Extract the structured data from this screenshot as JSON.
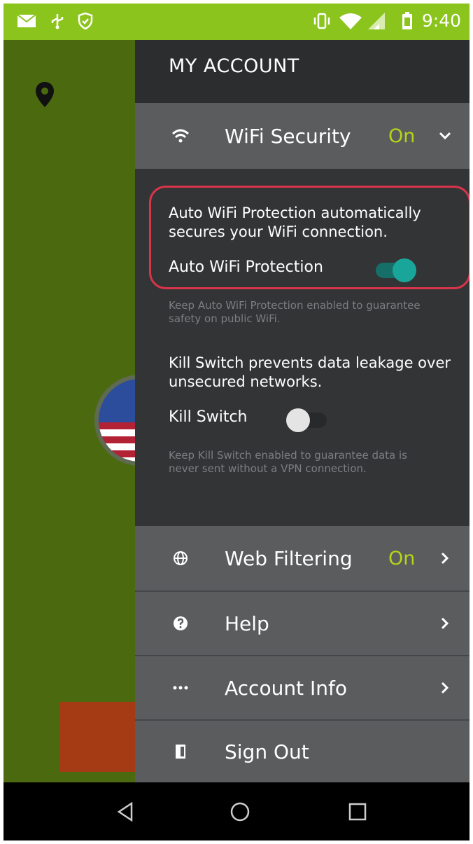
{
  "status_bar": {
    "time": "9:40",
    "icons": [
      "mail-icon",
      "usb-icon",
      "shield-icon",
      "vibrate-icon",
      "wifi-icon",
      "signal-icon",
      "battery-icon"
    ]
  },
  "drawer": {
    "title": "MY ACCOUNT",
    "wifi_security": {
      "label": "WiFi Security",
      "status": "On",
      "icon": "wifi-icon",
      "chevron": "chevron-down-icon"
    },
    "auto_wifi": {
      "description": "Auto WiFi Protection automatically secures your WiFi connection.",
      "label": "Auto WiFi Protection",
      "enabled": true,
      "hint": "Keep Auto WiFi Protection enabled to guarantee safety on public WiFi."
    },
    "kill_switch": {
      "description": "Kill Switch prevents data leakage over unsecured networks.",
      "label": "Kill Switch",
      "enabled": false,
      "hint": "Keep Kill Switch enabled to guarantee data is never sent without a VPN connection."
    },
    "items": [
      {
        "label": "Web Filtering",
        "status": "On",
        "icon": "globe-icon"
      },
      {
        "label": "Help",
        "icon": "help-icon"
      },
      {
        "label": "Account Info",
        "icon": "more-icon"
      },
      {
        "label": "Sign Out",
        "icon": "sign-out-icon"
      }
    ]
  },
  "colors": {
    "status_bar": "#8ac41c",
    "accent_on": "#b6d419",
    "toggle_on": "#1aa59a",
    "highlight": "#d8344a"
  }
}
